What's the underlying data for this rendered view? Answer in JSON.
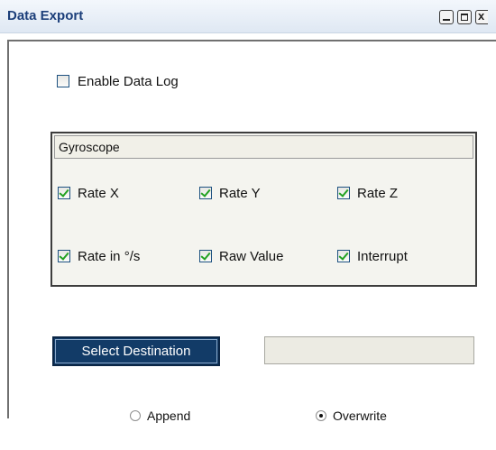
{
  "window": {
    "title": "Data Export",
    "close_glyph": "x"
  },
  "enable_log": {
    "label": "Enable Data Log",
    "checked": false
  },
  "group": {
    "title": "Gyroscope",
    "options": [
      {
        "label": "Rate X",
        "checked": true
      },
      {
        "label": "Rate Y",
        "checked": true
      },
      {
        "label": "Rate Z",
        "checked": true
      },
      {
        "label": "Rate in °/s",
        "checked": true
      },
      {
        "label": "Raw Value",
        "checked": true
      },
      {
        "label": "Interrupt",
        "checked": true
      }
    ]
  },
  "destination": {
    "button_label": "Select Destination",
    "path_value": ""
  },
  "write_mode": {
    "append_label": "Append",
    "overwrite_label": "Overwrite",
    "selected": "Overwrite"
  },
  "colors": {
    "title_text": "#1c3f7a",
    "button_bg": "#123b67",
    "check_mark": "#21a121"
  }
}
